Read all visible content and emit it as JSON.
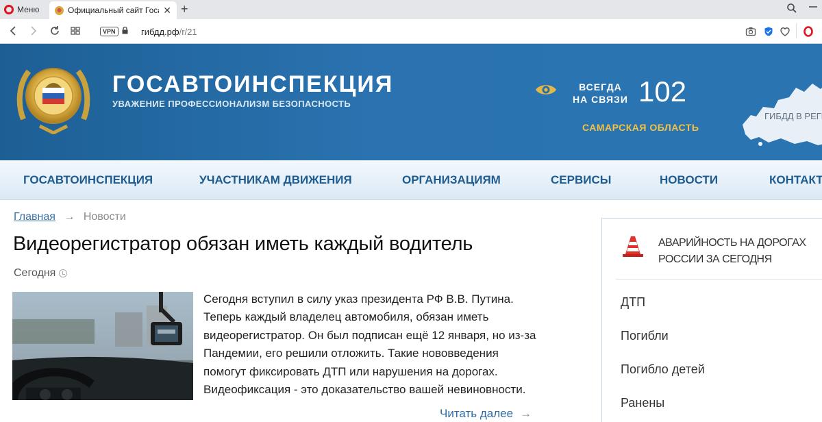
{
  "browser": {
    "menu_label": "Меню",
    "tab_title": "Официальный сайт Госав",
    "tab_close": "✕",
    "new_tab": "+",
    "url_domain": "гибдд.рф",
    "url_path": "/r/21",
    "vpn_label": "VPN"
  },
  "header": {
    "title": "ГОСАВТОИНСПЕКЦИЯ",
    "subtitle": "УВАЖЕНИЕ ПРОФЕССИОНАЛИЗМ БЕЗОПАСНОСТЬ",
    "always_line1": "ВСЕГДА",
    "always_line2": "НА СВЯЗИ",
    "phone": "102",
    "region": "САМАРСКАЯ ОБЛАСТЬ",
    "map_label": "ГИБДД В РЕГИ"
  },
  "nav": {
    "items": [
      "ГОСАВТОИНСПЕКЦИЯ",
      "УЧАСТНИКАМ ДВИЖЕНИЯ",
      "ОРГАНИЗАЦИЯМ",
      "СЕРВИСЫ",
      "НОВОСТИ",
      "КОНТАКТ"
    ]
  },
  "breadcrumb": {
    "home": "Главная",
    "separator": "→",
    "current": "Новости"
  },
  "article": {
    "title": "Видеорегистратор обязан иметь каждый водитель",
    "date": "Сегодня",
    "lines": [
      "Сегодня вступил в силу указ президента РФ В.В. Путина.",
      "Теперь каждый владелец автомобиля, обязан иметь",
      "видеорегистратор. Он был подписан ещё 12 января, но из-за",
      "Пандемии, его решили отложить. Такие нововведения",
      "помогут фиксировать ДТП или нарушения на дорогах.",
      "Видеофиксация - это доказательство вашей невиновности."
    ],
    "read_more": "Читать далее",
    "read_more_arrow": "→"
  },
  "sidebar": {
    "title_line1": "Аварийность на дорогах",
    "title_line2": "России за сегодня",
    "stats": [
      "ДТП",
      "Погибли",
      "Погибло детей",
      "Ранены"
    ]
  },
  "colors": {
    "header_blue": "#2a73b0",
    "nav_text": "#1e5b8f",
    "region_gold": "#f3c243",
    "link_blue": "#2d6aa3"
  }
}
